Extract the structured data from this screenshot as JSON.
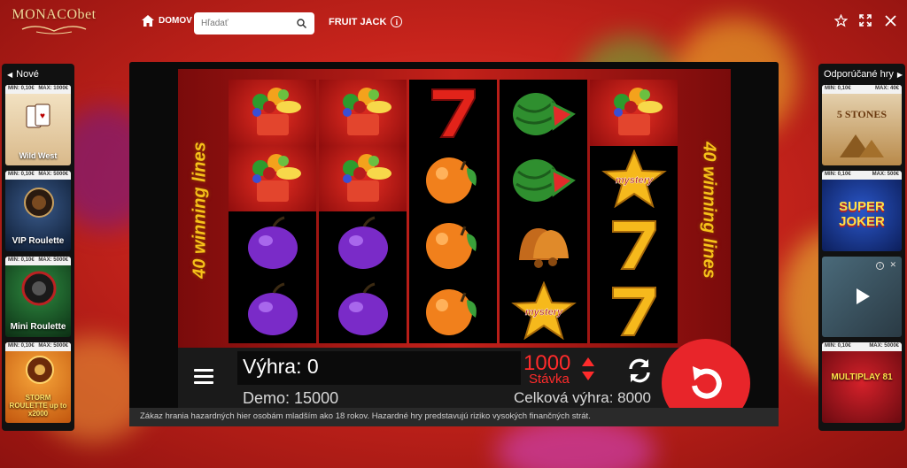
{
  "header": {
    "logo_text": "MONACObet",
    "home_label": "DOMOV",
    "search_placeholder": "Hľadať",
    "game_title": "FRUIT JACK"
  },
  "left_panel": {
    "title": "Nové",
    "games": [
      {
        "name": "Wild West",
        "min": "MIN: 0,10€",
        "max": "MAX: 1000€"
      },
      {
        "name": "VIP Roulette",
        "min": "MIN: 0,10€",
        "max": "MAX: 5000€"
      },
      {
        "name": "Mini Roulette",
        "min": "MIN: 0,10€",
        "max": "MAX: 5000€"
      },
      {
        "name": "STORM ROULETTE up to x2000",
        "min": "MIN: 0,10€",
        "max": "MAX: 5000€"
      }
    ]
  },
  "right_panel": {
    "title": "Odporúčané hry",
    "games": [
      {
        "name": "5 STONES",
        "min": "MIN: 0,10€",
        "max": "MAX: 40€"
      },
      {
        "name": "SUPER JOKER",
        "min": "MIN: 0,10€",
        "max": "MAX: 500€"
      },
      {
        "name": "",
        "min": "",
        "max": ""
      },
      {
        "name": "MULTIPLAY 81",
        "min": "MIN: 0,10€",
        "max": "MAX: 5000€"
      }
    ]
  },
  "game": {
    "winning_lines": "40 winning lines",
    "reels": [
      [
        "basket",
        "basket",
        "plum",
        "plum"
      ],
      [
        "basket",
        "basket",
        "plum",
        "plum"
      ],
      [
        "seven",
        "orange",
        "orange",
        "orange"
      ],
      [
        "watermelon",
        "watermelon",
        "bell",
        "star"
      ],
      [
        "basket",
        "star",
        "seven-gold",
        "seven-gold"
      ]
    ],
    "mystery_label": "mystery",
    "win_label": "Výhra:",
    "win_value": "0",
    "demo_label": "Demo:",
    "demo_value": "15000",
    "bet_value": "1000",
    "bet_label": "Stávka",
    "total_label": "Celková výhra:",
    "total_value": "8000"
  },
  "disclaimer": "Zákaz hrania hazardných hier osobám mladším ako 18 rokov. Hazardné hry predstavujú riziko vysokých finančných strát.",
  "colors": {
    "accent": "#e8252a",
    "bet": "#ff2b2b",
    "gold": "#f7c21a"
  }
}
